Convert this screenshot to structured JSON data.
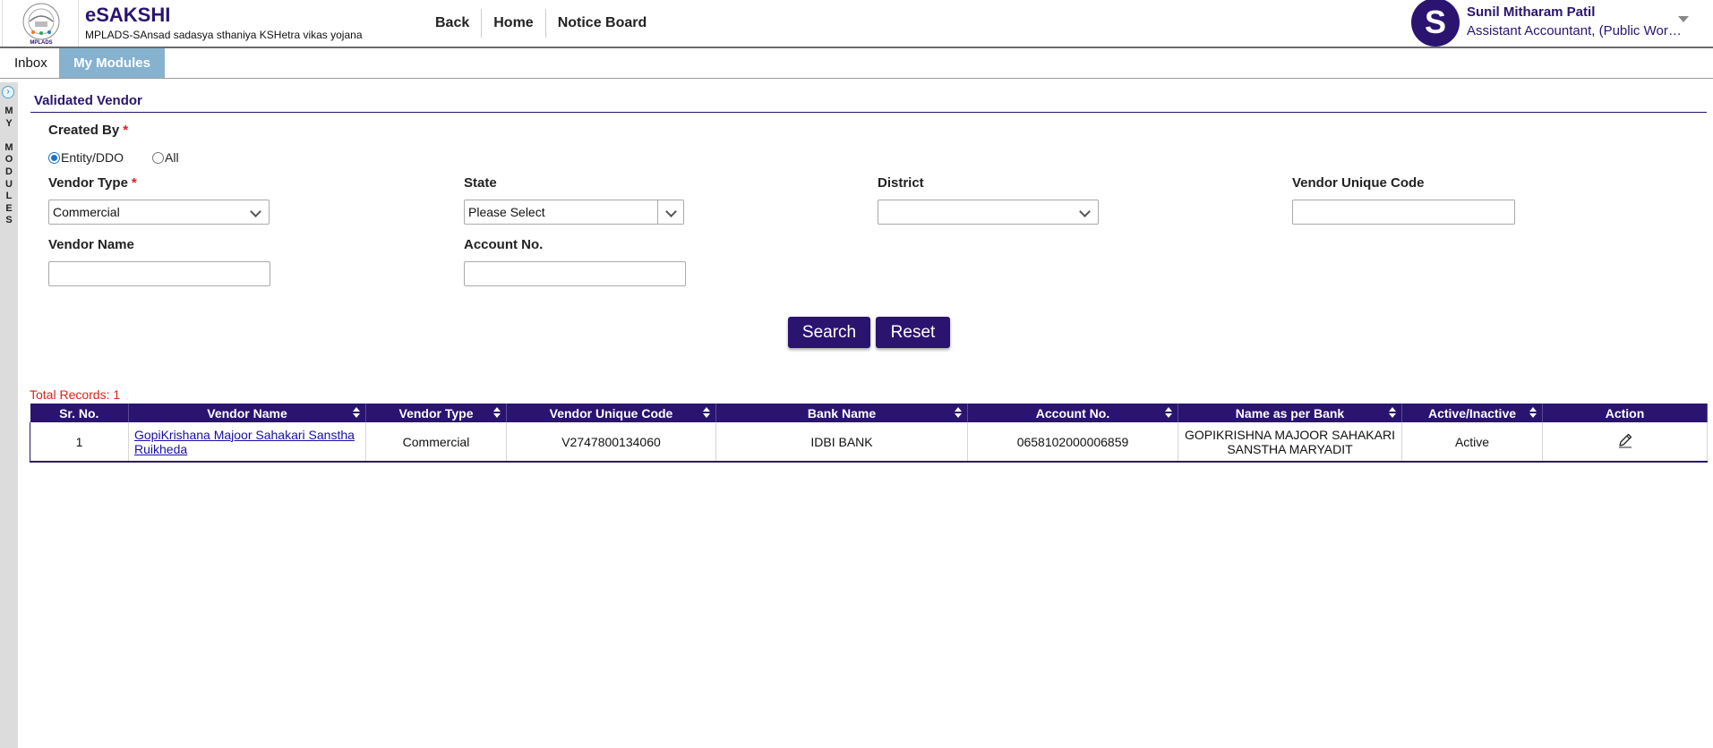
{
  "header": {
    "brand_title": "eSAKSHI",
    "brand_subtitle": "MPLADS-SAnsad sadasya sthaniya KSHetra vikas yojana",
    "logo_caption": "MPLADS",
    "nav": [
      "Back",
      "Home",
      "Notice Board"
    ],
    "user": {
      "avatar_letter": "S",
      "name": "Sunil Mitharam Patil",
      "role": "Assistant Accountant, (Public Work..."
    }
  },
  "tabs": {
    "inbox": "Inbox",
    "modules": "My Modules"
  },
  "side_rail": {
    "label": "MY MODULES"
  },
  "form": {
    "section_title": "Validated Vendor",
    "created_by": {
      "label": "Created By",
      "required": "*",
      "options": [
        "Entity/DDO",
        "All"
      ],
      "selected": "Entity/DDO"
    },
    "vendor_type": {
      "label": "Vendor Type",
      "required": "*",
      "value": "Commercial"
    },
    "state": {
      "label": "State",
      "value": "Please Select"
    },
    "district": {
      "label": "District",
      "value": ""
    },
    "vendor_unique_code": {
      "label": "Vendor Unique Code",
      "value": ""
    },
    "vendor_name": {
      "label": "Vendor Name",
      "value": ""
    },
    "account_no": {
      "label": "Account No.",
      "value": ""
    },
    "search_label": "Search",
    "reset_label": "Reset"
  },
  "results": {
    "total_records": "Total Records: 1",
    "columns": [
      "Sr. No.",
      "Vendor Name",
      "Vendor Type",
      "Vendor Unique Code",
      "Bank Name",
      "Account No.",
      "Name as per Bank",
      "Active/Inactive",
      "Action"
    ],
    "rows": [
      {
        "sr_no": "1",
        "vendor_name": "GopiKrishana Majoor Sahakari Sanstha Ruikheda",
        "vendor_type": "Commercial",
        "vendor_unique_code": "V2747800134060",
        "bank_name": "IDBI BANK",
        "account_no": "0658102000006859",
        "name_as_per_bank": "GOPIKRISHNA MAJOOR SAHAKARI SANSTHA MARYADIT",
        "status": "Active",
        "action_icon": "edit-pencil-icon"
      }
    ]
  },
  "colors": {
    "primary": "#2a1470",
    "tab_active": "#86b2d0",
    "required": "#e0201b",
    "link": "#1a0dab"
  }
}
